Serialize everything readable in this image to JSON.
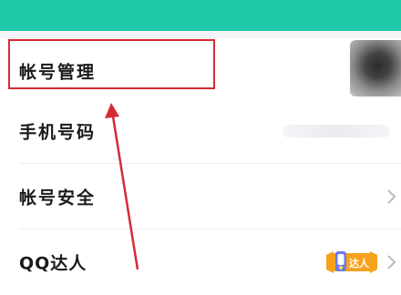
{
  "settings": {
    "items": [
      {
        "label": "帐号管理"
      },
      {
        "label": "手机号码"
      },
      {
        "label": "帐号安全"
      },
      {
        "label": "QQ达人",
        "badge_text": "达人"
      }
    ]
  },
  "colors": {
    "header": "#1ec9a8",
    "annotation": "#d52a36",
    "badge": "#f7a21c"
  },
  "icons": [
    "chevron-right-icon",
    "qq-daren-badge-icon"
  ]
}
